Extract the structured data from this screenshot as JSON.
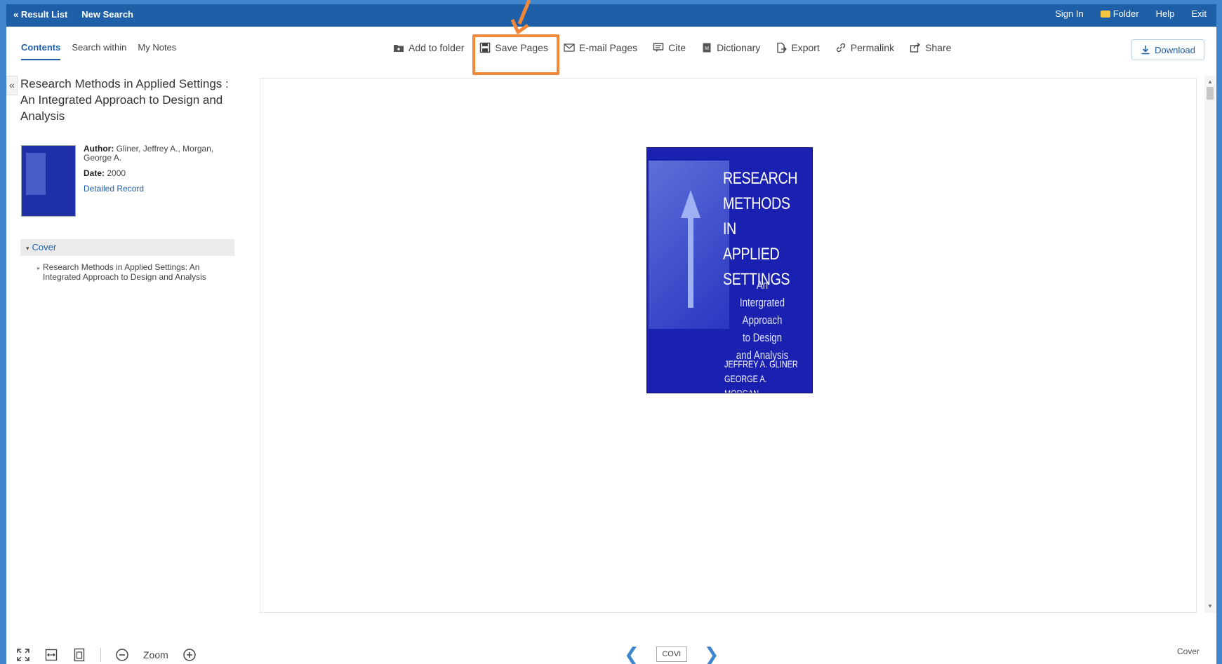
{
  "topbar": {
    "result_list": "« Result List",
    "new_search": "New Search",
    "sign_in": "Sign In",
    "folder": "Folder",
    "help": "Help",
    "exit": "Exit"
  },
  "tabs": [
    {
      "label": "Contents"
    },
    {
      "label": "Search within"
    },
    {
      "label": "My Notes"
    }
  ],
  "tools": [
    {
      "label": "Add to folder",
      "icon": "folder-add-icon"
    },
    {
      "label": "Save Pages",
      "icon": "save-icon"
    },
    {
      "label": "E-mail Pages",
      "icon": "mail-icon"
    },
    {
      "label": "Cite",
      "icon": "cite-icon"
    },
    {
      "label": "Dictionary",
      "icon": "dictionary-icon"
    },
    {
      "label": "Export",
      "icon": "export-icon"
    },
    {
      "label": "Permalink",
      "icon": "link-icon"
    },
    {
      "label": "Share",
      "icon": "share-icon"
    }
  ],
  "download_label": "Download",
  "book": {
    "title": "Research Methods in Applied Settings : An Integrated Approach to Design and Analysis",
    "author_label": "Author:",
    "author": "Gliner, Jeffrey A., Morgan, George A.",
    "date_label": "Date:",
    "date": "2000",
    "detailed_record": "Detailed Record"
  },
  "toc": {
    "head": "Cover",
    "item": "Research Methods in Applied Settings: An Integrated Approach to Design and Analysis"
  },
  "cover": {
    "title_lines": [
      "RESEARCH",
      "METHODS",
      "IN APPLIED",
      "SETTINGS"
    ],
    "subtitle_lines": [
      "An Intergrated",
      "Approach",
      "to Design",
      "and Analysis"
    ],
    "authors": [
      "JEFFREY A. GLINER",
      "GEORGE A. MORGAN"
    ]
  },
  "bottom": {
    "zoom_label": "Zoom",
    "page_value": "COVI",
    "current_section": "Cover"
  },
  "colors": {
    "topbar": "#1e5fa8",
    "highlight": "#f0883a",
    "frame_bg": "#3f86cf",
    "cover": "#1a20b0"
  }
}
